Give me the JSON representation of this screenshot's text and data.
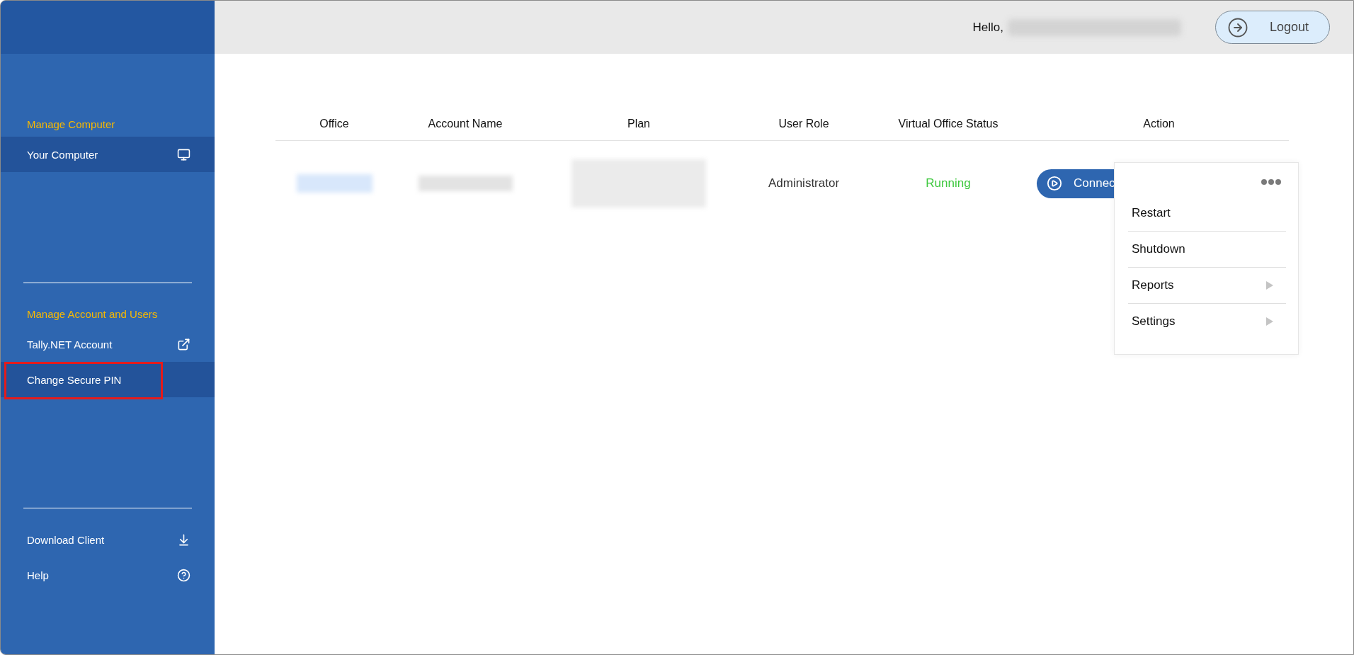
{
  "sidebar": {
    "sections": [
      {
        "heading": "Manage Computer",
        "items": [
          {
            "label": "Your Computer",
            "selected": true,
            "outlined": false
          }
        ]
      },
      {
        "heading": "Manage Account and Users",
        "items": [
          {
            "label": "Tally.NET Account",
            "selected": false,
            "outlined": false
          },
          {
            "label": "Change Secure PIN",
            "selected": true,
            "outlined": true
          }
        ]
      },
      {
        "items": [
          {
            "label": "Download Client",
            "selected": false,
            "outlined": false
          },
          {
            "label": "Help",
            "selected": false,
            "outlined": false
          }
        ]
      }
    ]
  },
  "header": {
    "greeting": "Hello,",
    "logout": "Logout"
  },
  "table": {
    "columns": [
      "Office",
      "Account Name",
      "Plan",
      "User Role",
      "Virtual Office Status",
      "Action"
    ],
    "rows": [
      {
        "cells": [
          {
            "kind": "blurred"
          },
          {
            "kind": "blurred"
          },
          {
            "kind": "blurred"
          },
          {
            "kind": "text",
            "text": "Administrator"
          },
          {
            "kind": "status",
            "text": "Running"
          },
          {
            "kind": "action",
            "text": "Connec"
          }
        ]
      }
    ]
  },
  "menu": {
    "items": [
      {
        "label": "Restart",
        "submenu": false
      },
      {
        "label": "Shutdown",
        "submenu": false
      },
      {
        "label": "Reports",
        "submenu": true
      },
      {
        "label": "Settings",
        "submenu": true
      }
    ]
  }
}
